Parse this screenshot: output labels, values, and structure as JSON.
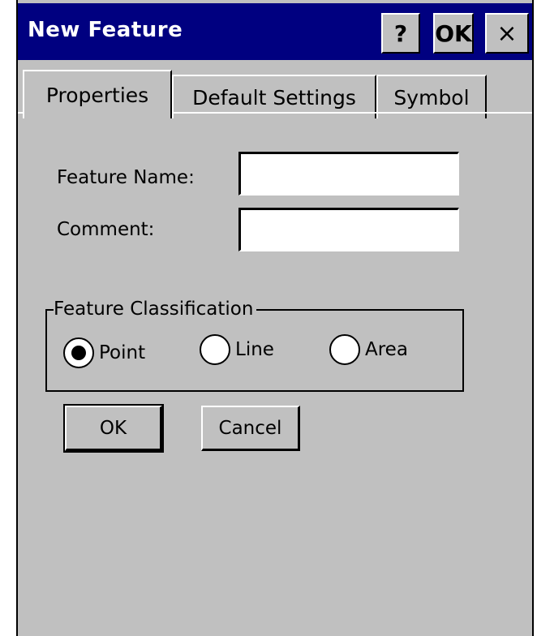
{
  "window": {
    "title": "New Feature",
    "help_label": "?",
    "ok_label": "OK",
    "close_label": "×"
  },
  "tabs": [
    {
      "label": "Properties",
      "selected": true
    },
    {
      "label": "Default Settings",
      "selected": false
    },
    {
      "label": "Symbol",
      "selected": false
    }
  ],
  "form": {
    "feature_name_label": "Feature Name:",
    "feature_name_value": "",
    "comment_label": "Comment:",
    "comment_value": ""
  },
  "classification": {
    "legend": "Feature Classification",
    "options": [
      {
        "label": "Point",
        "selected": true
      },
      {
        "label": "Line",
        "selected": false
      },
      {
        "label": "Area",
        "selected": false
      }
    ]
  },
  "buttons": {
    "ok_label": "OK",
    "cancel_label": "Cancel"
  },
  "colors": {
    "title_bar": "#000080",
    "face": "#c0c0c0"
  }
}
